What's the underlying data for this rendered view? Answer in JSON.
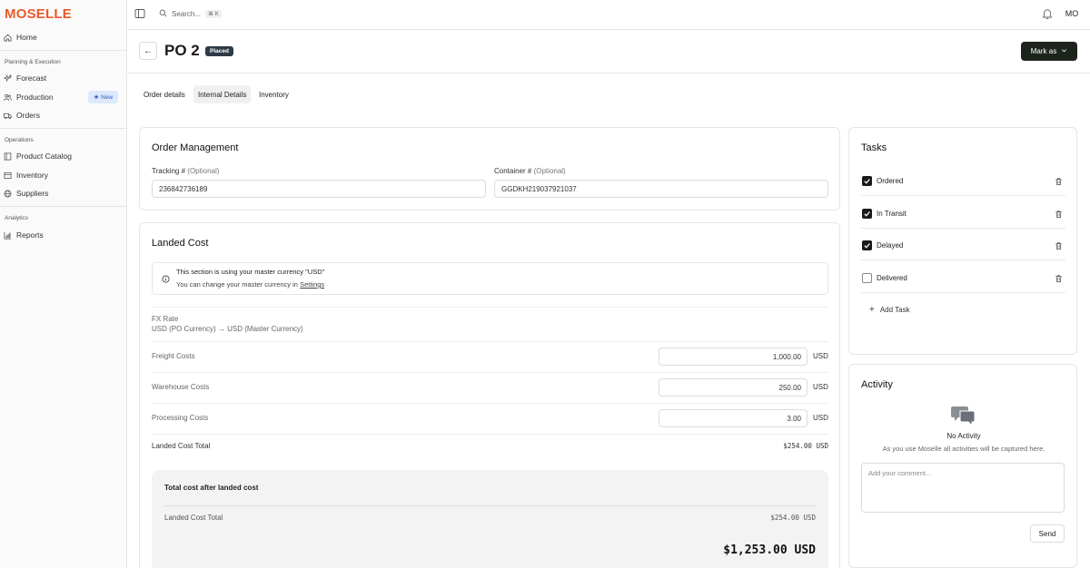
{
  "sidebar": {
    "logo": "MOSELLE",
    "home": "Home",
    "section_planning": "Planning & Execution",
    "forecast": "Forecast",
    "production": "Production",
    "new_badge": "New",
    "orders": "Orders",
    "section_operations": "Operations",
    "product_catalog": "Product Catalog",
    "inventory": "Inventory",
    "suppliers": "Suppliers",
    "section_analytics": "Analytics",
    "reports": "Reports"
  },
  "topbar": {
    "search_placeholder": "Search...",
    "shortcut": "⌘ K",
    "avatar_initials": "MO"
  },
  "header": {
    "title": "PO 2",
    "status": "Placed",
    "mark_as": "Mark as"
  },
  "tabs": {
    "order_details": "Order details",
    "internal_details": "Internal Details",
    "inventory": "Inventory"
  },
  "order_management": {
    "title": "Order Management",
    "tracking_label": "Tracking #",
    "tracking_optional": "(Optional)",
    "tracking_value": "236842736189",
    "container_label": "Container #",
    "container_optional": "(Optional)",
    "container_value": "GGDKH219037921037"
  },
  "landed_cost": {
    "title": "Landed Cost",
    "info_line1": "This section is using your master currency \"USD\"",
    "info_line2": "You can change your master currency in",
    "info_link": "Settings",
    "fx_label": "FX Rate",
    "fx_value": "USD (PO Currency) → USD (Master Currency)",
    "freight_label": "Freight Costs",
    "freight_value": "1,000.00",
    "warehouse_label": "Warehouse Costs",
    "warehouse_value": "250.00",
    "processing_label": "Processing Costs",
    "processing_value": "3.00",
    "currency": "USD",
    "total_label": "Landed Cost Total",
    "total_value": "$254.00 USD",
    "panel_title": "Total cost after landed cost",
    "panel_total_label": "Landed Cost Total",
    "panel_total_value": "$254.00 USD",
    "grand_total": "$1,253.00 USD"
  },
  "tasks": {
    "title": "Tasks",
    "items": [
      {
        "label": "Ordered",
        "checked": true
      },
      {
        "label": "In Transit",
        "checked": true
      },
      {
        "label": "Delayed",
        "checked": true
      },
      {
        "label": "Delivered",
        "checked": false
      }
    ],
    "add_task": "Add Task"
  },
  "activity": {
    "title": "Activity",
    "empty_title": "No Activity",
    "empty_desc": "As you use Moselle all activities will be captured here.",
    "comment_placeholder": "Add your comment...",
    "send": "Send"
  },
  "colors": {
    "brand": "#ea5a2c",
    "primary_button": "#1c241c",
    "badge_bg": "#2e3a46",
    "new_badge_bg": "#dde8fb"
  }
}
